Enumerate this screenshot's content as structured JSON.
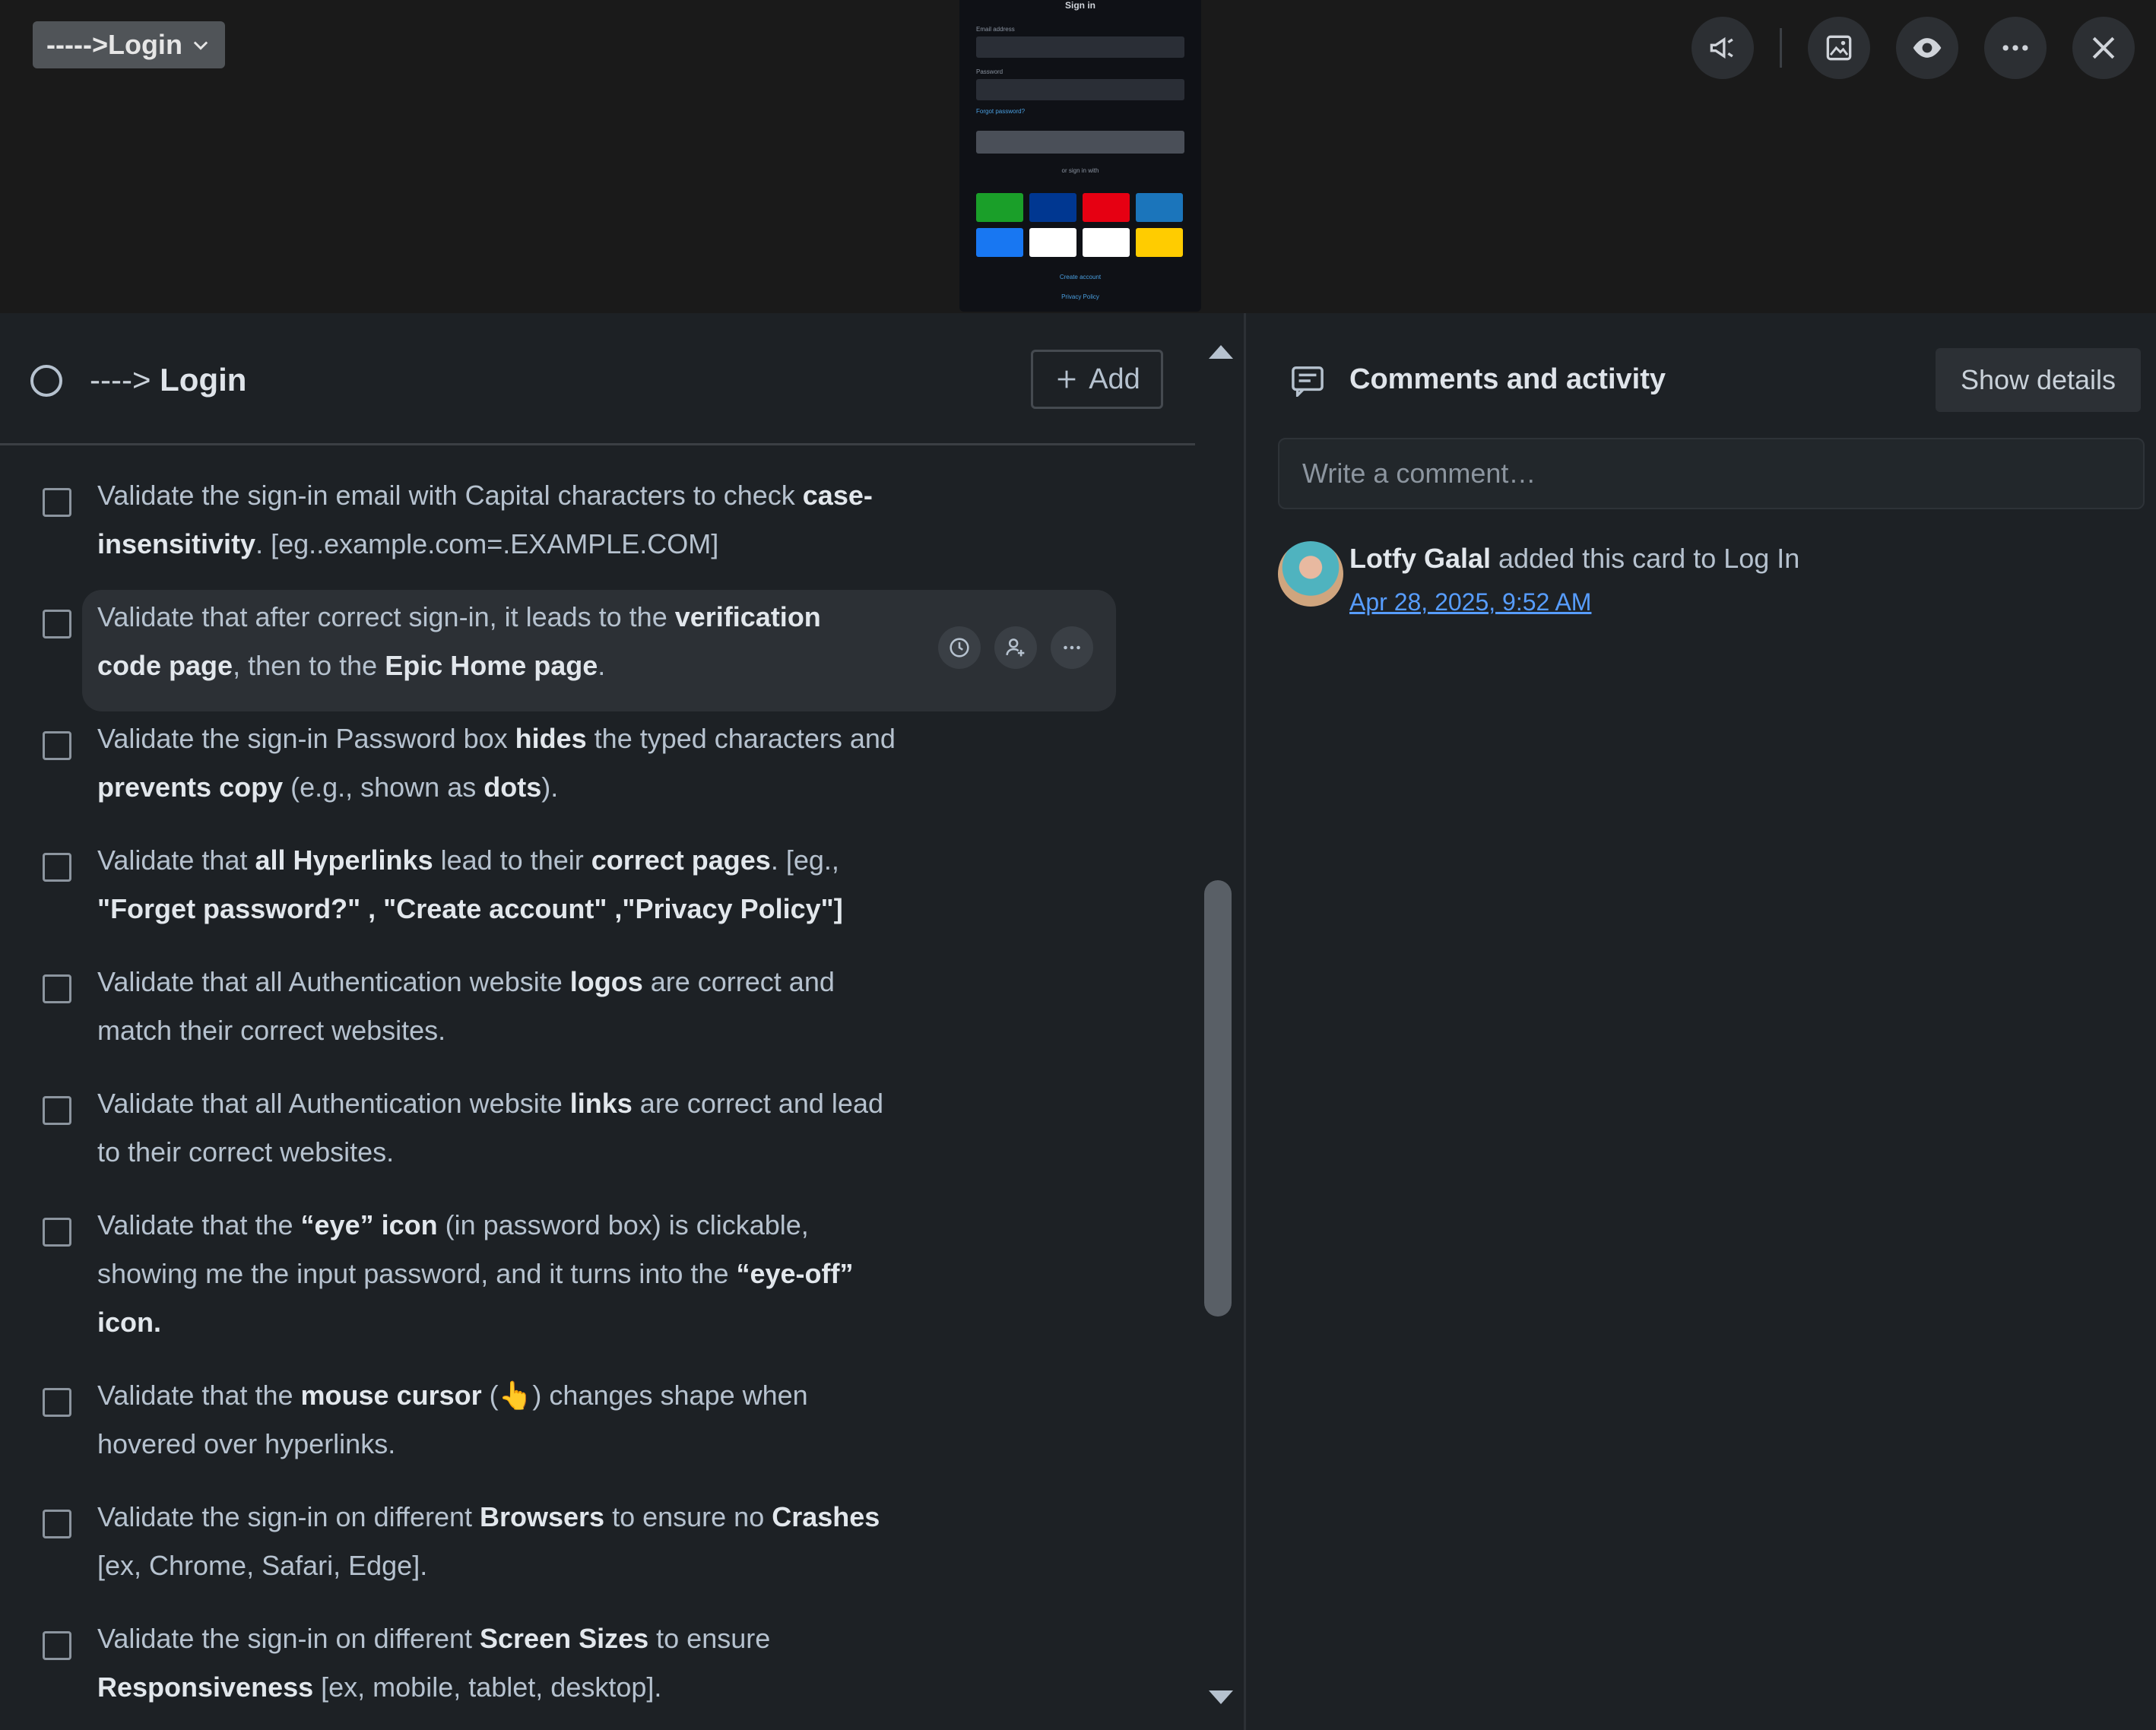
{
  "list_selector": {
    "label": "----->Login"
  },
  "preview": {
    "title": "Sign in",
    "email_label": "Email address",
    "password_label": "Password",
    "forgot_link": "Forgot password?",
    "signin_button": "Sign in",
    "or_text": "or sign in with",
    "create_link": "Create account",
    "privacy_link": "Privacy Policy",
    "logo_colors": [
      "#1a9f29",
      "#003791",
      "#e60012",
      "#1b75bb",
      "#1877f2",
      "#ffffff",
      "#ffffff",
      "#ffcc00"
    ]
  },
  "top_icons": [
    "megaphone-icon",
    "image-icon",
    "eye-icon",
    "more-icon",
    "close-icon"
  ],
  "checklist": {
    "title_prefix": "---->",
    "title": "Login",
    "add_label": "Add"
  },
  "items": [
    {
      "segs": [
        [
          "Validate the sign-in email with Capital characters to check ",
          false
        ],
        [
          "case-",
          true
        ],
        [
          "\n",
          false
        ],
        [
          "insensitivity",
          true
        ],
        [
          ". [eg..example.com=.EXAMPLE.COM]",
          false
        ]
      ]
    },
    {
      "segs": [
        [
          "Validate that after correct sign-in, it leads to the ",
          false
        ],
        [
          "verification",
          true
        ],
        [
          "\n",
          false
        ],
        [
          "code page",
          true
        ],
        [
          ", then to the ",
          false
        ],
        [
          "Epic Home page",
          true
        ],
        [
          ".",
          false
        ]
      ]
    },
    {
      "segs": [
        [
          "Validate the sign-in Password box ",
          false
        ],
        [
          "hides",
          true
        ],
        [
          " the typed characters and",
          false
        ],
        [
          "\n",
          false
        ],
        [
          "prevents copy",
          true
        ],
        [
          " (e.g., shown as ",
          false
        ],
        [
          "dots",
          true
        ],
        [
          ").",
          false
        ]
      ]
    },
    {
      "segs": [
        [
          "Validate that ",
          false
        ],
        [
          "all Hyperlinks",
          true
        ],
        [
          " lead to their ",
          false
        ],
        [
          "correct pages",
          true
        ],
        [
          ". [eg.,",
          false
        ],
        [
          "\n",
          false
        ],
        [
          "\"Forget password?\" , \"Create account\" ,\"Privacy Policy\"]",
          true
        ]
      ]
    },
    {
      "segs": [
        [
          "Validate that all Authentication website ",
          false
        ],
        [
          "logos",
          true
        ],
        [
          " are correct and",
          false
        ],
        [
          "\n",
          false
        ],
        [
          "match their correct websites.",
          false
        ]
      ]
    },
    {
      "segs": [
        [
          "Validate that all Authentication website ",
          false
        ],
        [
          "links",
          true
        ],
        [
          " are correct and lead",
          false
        ],
        [
          "\n",
          false
        ],
        [
          "to their correct websites.",
          false
        ]
      ]
    },
    {
      "segs": [
        [
          "Validate that the ",
          false
        ],
        [
          "“eye” icon",
          true
        ],
        [
          " (in password box) is clickable,",
          false
        ],
        [
          "\n",
          false
        ],
        [
          "showing me the input password, and it turns into the ",
          false
        ],
        [
          "“eye-off”",
          true
        ],
        [
          "\n",
          false
        ],
        [
          "icon.",
          true
        ]
      ]
    },
    {
      "segs": [
        [
          "Validate that the ",
          false
        ],
        [
          "mouse cursor",
          true
        ],
        [
          " (👆) changes shape when",
          false
        ],
        [
          "\n",
          false
        ],
        [
          "hovered over hyperlinks.",
          false
        ]
      ]
    },
    {
      "segs": [
        [
          "Validate the sign-in on different ",
          false
        ],
        [
          "Browsers",
          true
        ],
        [
          " to ensure no ",
          false
        ],
        [
          "Crashes",
          true
        ],
        [
          "\n",
          false
        ],
        [
          "[ex, Chrome, Safari, Edge].",
          false
        ]
      ]
    },
    {
      "segs": [
        [
          "Validate the sign-in on different ",
          false
        ],
        [
          "Screen Sizes",
          true
        ],
        [
          " to ensure",
          false
        ],
        [
          "\n",
          false
        ],
        [
          "Responsiveness",
          true
        ],
        [
          " [ex, mobile, tablet, desktop].",
          false
        ]
      ]
    }
  ],
  "comments": {
    "title": "Comments and activity",
    "show_details": "Show details",
    "placeholder": "Write a comment…",
    "activity": {
      "user": "Lotfy Galal",
      "action": " added this card to Log In",
      "date": "Apr 28, 2025, 9:52 AM"
    }
  }
}
